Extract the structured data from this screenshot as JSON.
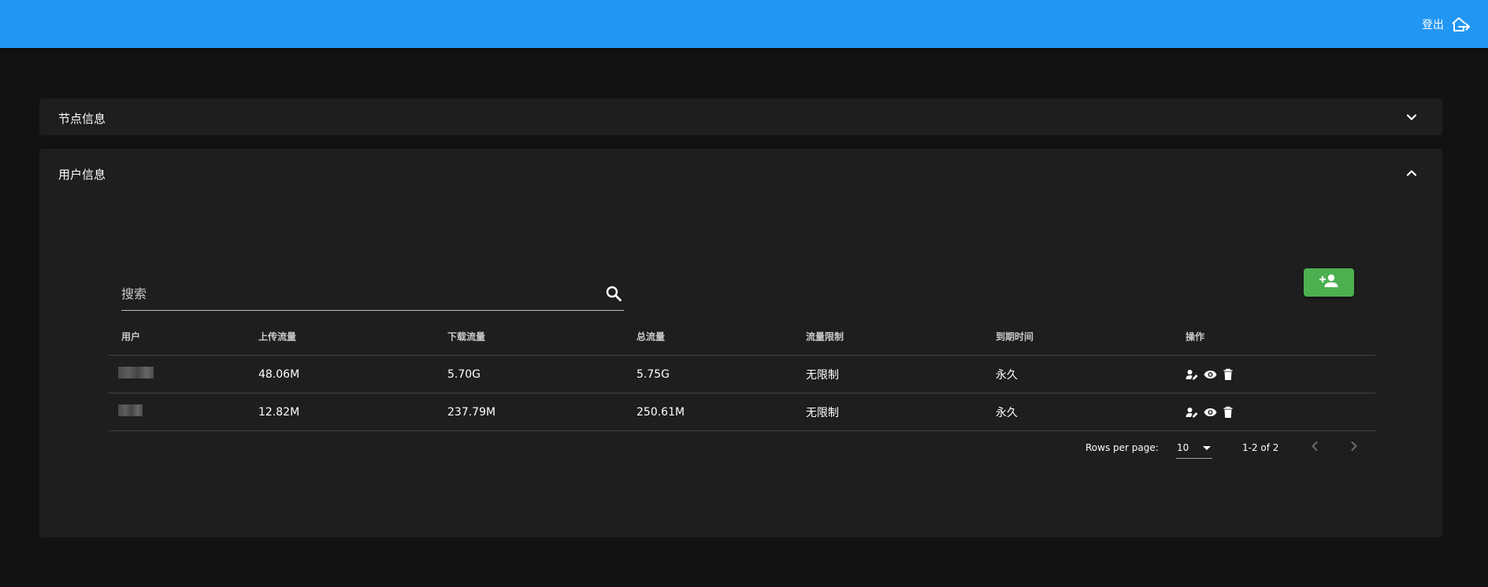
{
  "header": {
    "logout_label": "登出",
    "bar_color": "#2196f3"
  },
  "panels": {
    "node": {
      "title": "节点信息",
      "expanded": false
    },
    "user": {
      "title": "用户信息",
      "expanded": true
    }
  },
  "search": {
    "placeholder": "搜索",
    "value": ""
  },
  "add_button": {
    "icon": "account-plus-icon",
    "color": "#4caf50"
  },
  "table": {
    "columns": [
      "用户",
      "上传流量",
      "下载流量",
      "总流量",
      "流量限制",
      "到期时间",
      "操作"
    ],
    "rows": [
      {
        "upload": "48.06M",
        "download": "5.70G",
        "total": "5.75G",
        "limit": "无限制",
        "expire": "永久"
      },
      {
        "upload": "12.82M",
        "download": "237.79M",
        "total": "250.61M",
        "limit": "无限制",
        "expire": "永久"
      }
    ],
    "row_actions": [
      "edit-user-icon",
      "eye-icon",
      "delete-icon"
    ]
  },
  "pagination": {
    "rows_per_page_label": "Rows per page:",
    "rows_per_page": "10",
    "range": "1-2 of 2"
  }
}
